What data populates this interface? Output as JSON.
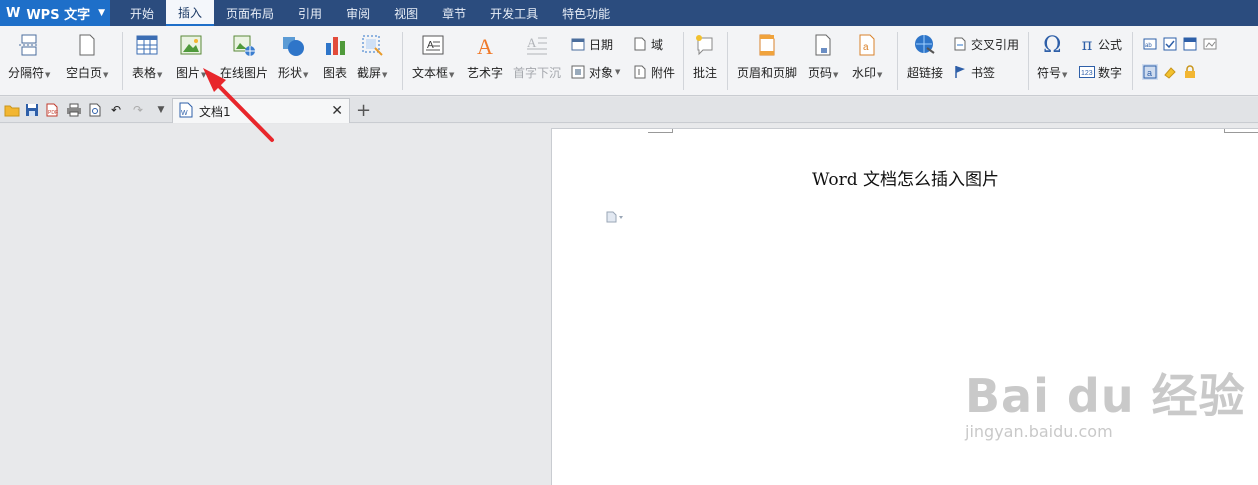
{
  "app": {
    "name": "WPS 文字"
  },
  "menu": {
    "tabs": [
      {
        "label": "开始"
      },
      {
        "label": "插入"
      },
      {
        "label": "页面布局"
      },
      {
        "label": "引用"
      },
      {
        "label": "审阅"
      },
      {
        "label": "视图"
      },
      {
        "label": "章节"
      },
      {
        "label": "开发工具"
      },
      {
        "label": "特色功能"
      }
    ],
    "active": "插入"
  },
  "ribbon": {
    "break": "分隔符",
    "blank_page": "空白页",
    "table": "表格",
    "picture": "图片",
    "online_picture": "在线图片",
    "shape": "形状",
    "chart": "图表",
    "screenshot": "截屏",
    "textbox": "文本框",
    "wordart": "艺术字",
    "dropcap": "首字下沉",
    "date": "日期",
    "object": "对象",
    "field": "域",
    "attachment": "附件",
    "comment": "批注",
    "header_footer": "页眉和页脚",
    "page_number": "页码",
    "watermark": "水印",
    "hyperlink": "超链接",
    "cross_ref": "交叉引用",
    "bookmark": "书签",
    "symbol": "符号",
    "formula": "公式",
    "number": "数字"
  },
  "tabs": {
    "document": "文档1"
  },
  "document": {
    "title": "Word 文档怎么插入图片"
  },
  "watermark": {
    "brand": "Bai du 经验",
    "url": "jingyan.baidu.com"
  },
  "colors": {
    "menubar": "#2b4c7e",
    "app_button": "#1e6fc9",
    "annotation_arrow": "#e8262b"
  }
}
